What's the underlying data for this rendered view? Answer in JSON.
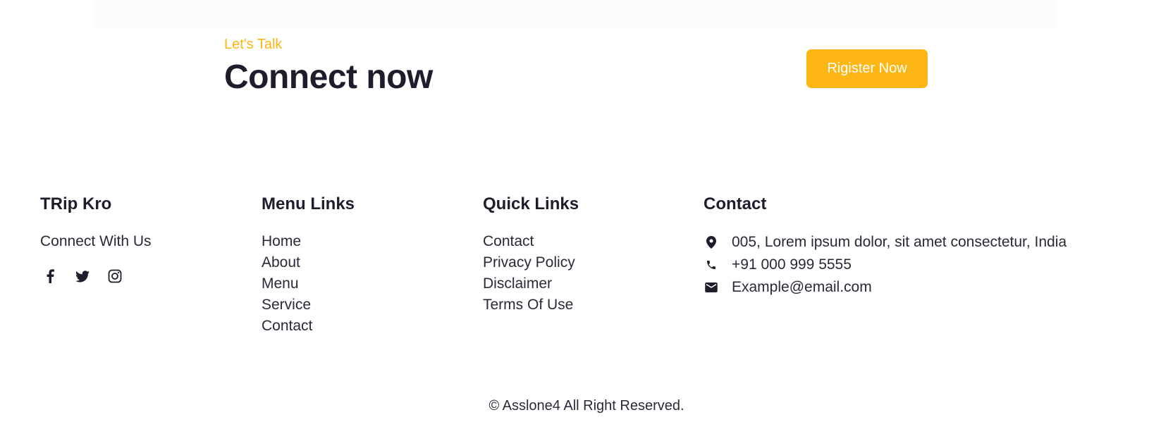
{
  "cta": {
    "eyebrow": "Let's Talk",
    "title": "Connect now",
    "button_label": "Rigister Now"
  },
  "footer": {
    "brand": {
      "title": "TRip Kro",
      "tagline": "Connect With Us",
      "social_icons": [
        "facebook-icon",
        "twitter-icon",
        "instagram-icon"
      ]
    },
    "menu_links": {
      "title": "Menu Links",
      "items": [
        "Home",
        "About",
        "Menu",
        "Service",
        "Contact"
      ]
    },
    "quick_links": {
      "title": "Quick Links",
      "items": [
        "Contact",
        "Privacy Policy",
        "Disclaimer",
        "Terms Of Use"
      ]
    },
    "contact": {
      "title": "Contact",
      "address": "005, Lorem ipsum dolor, sit amet consectetur, India",
      "phone": "+91 000 999 5555",
      "email": "Example@email.com",
      "icons": [
        "location-pin-icon",
        "phone-icon",
        "mail-icon"
      ]
    },
    "copyright": "© Asslone4 All Right Reserved."
  },
  "colors": {
    "accent": "#fdb614",
    "text_dark": "#1e1d2b"
  }
}
